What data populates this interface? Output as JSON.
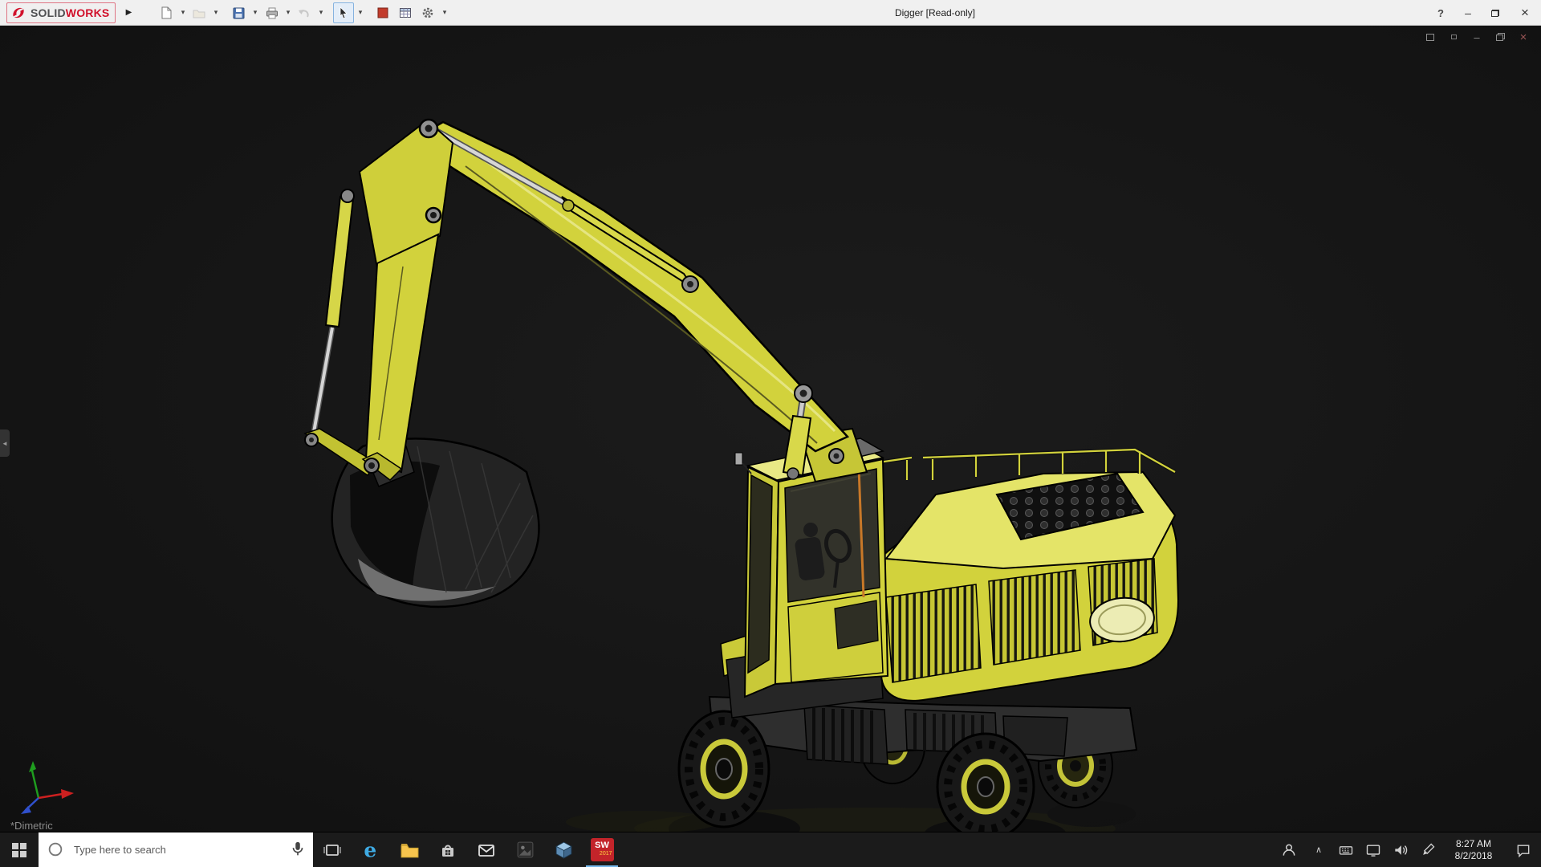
{
  "titlebar": {
    "brand": {
      "solid": "SOLID",
      "works": "WORKS"
    },
    "flyout_glyph": "▶",
    "dropdown_glyph": "▾",
    "title": "Digger [Read-only]",
    "controls": {
      "help": "?",
      "minimize": "–",
      "close": "×"
    }
  },
  "document_window_controls": {
    "minimize": "–",
    "close": "×"
  },
  "viewport": {
    "view_orientation_label": "*Dimetric"
  },
  "taskbar": {
    "search": {
      "placeholder": "Type here to search"
    },
    "apps": {
      "solidworks_2017": {
        "label": "SW",
        "year": "2017"
      }
    },
    "tray": {
      "overflow_glyph": "∧",
      "time": "8:27 AM",
      "date": "8/2/2018"
    }
  },
  "colors": {
    "machine_yellow": "#d2d23c",
    "titlebar_bg": "#f0f0f0",
    "viewport_bg": "#151515",
    "taskbar_bg": "#1b1b1b",
    "brand_red": "#d1112b",
    "selection_blue": "#86b3e0"
  }
}
